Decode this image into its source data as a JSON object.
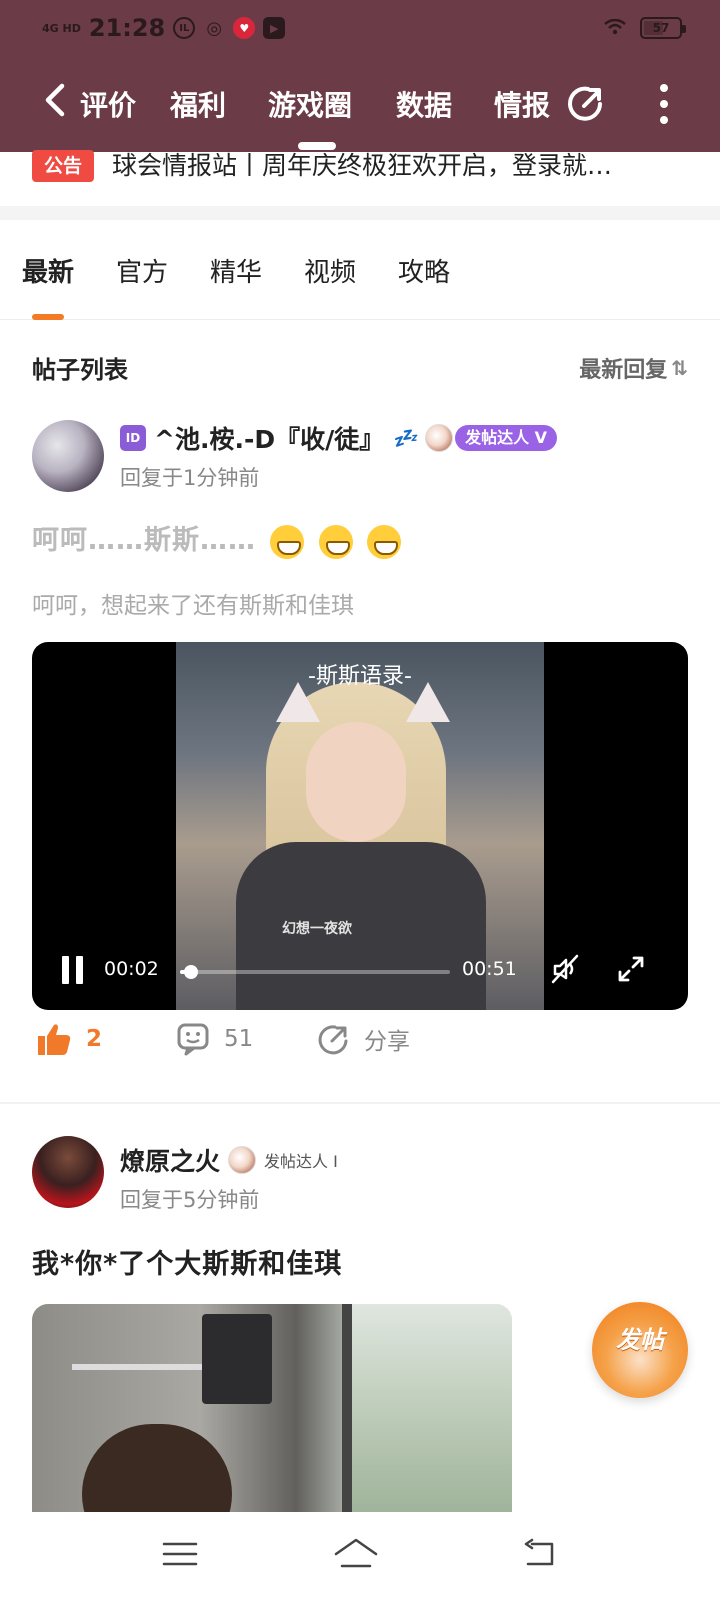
{
  "status_bar": {
    "signal": "4G HD",
    "time": "21:28",
    "battery": "57",
    "battery_level": 0.57
  },
  "top_nav": {
    "tabs": [
      "评价",
      "福利",
      "游戏圈",
      "数据",
      "情报"
    ],
    "active_tab": "游戏圈"
  },
  "notice": {
    "badge": "公告",
    "text": "球会情报站丨周年庆终极狂欢开启，登录就…"
  },
  "content_tabs": [
    "最新",
    "官方",
    "精华",
    "视频",
    "攻略"
  ],
  "list_header": {
    "title": "帖子列表",
    "sort_label": "最新回复",
    "sort_icon": "⇅"
  },
  "posts": [
    {
      "user_prefix_icon": "ID",
      "username": "^池.桉.-D『收/徒』",
      "username_suffix": "💤",
      "badge": "发帖达人 V",
      "reply_time": "回复于1分钟前",
      "title": "呵呵……斯斯……",
      "emoji_count_text": "😁😁😁",
      "body": "呵呵，想起来了还有斯斯和佳琪",
      "video": {
        "caption": "-斯斯语录-",
        "subtitle": "幻想一夜欲",
        "current_time": "00:02",
        "duration": "00:51",
        "progress": 0.04
      },
      "likes": "2",
      "comments": "51",
      "share_label": "分享"
    },
    {
      "username": "燎原之火",
      "badge": "发帖达人 I",
      "reply_time": "回复于5分钟前",
      "title": "我*你*了个大斯斯和佳琪"
    }
  ],
  "fab": {
    "label": "发帖"
  },
  "colors": {
    "header_bg": "#6b3b47",
    "accent": "#f47a23",
    "notice_red": "#ef4b43",
    "badge_purple": "#9a63e6"
  },
  "icons": [
    "back-arrow-icon",
    "share-icon",
    "more-icon",
    "sort-icon",
    "like-icon",
    "comment-icon",
    "share-icon",
    "pause-icon",
    "mute-icon",
    "fullscreen-icon",
    "menu-icon",
    "home-icon",
    "back-icon"
  ]
}
